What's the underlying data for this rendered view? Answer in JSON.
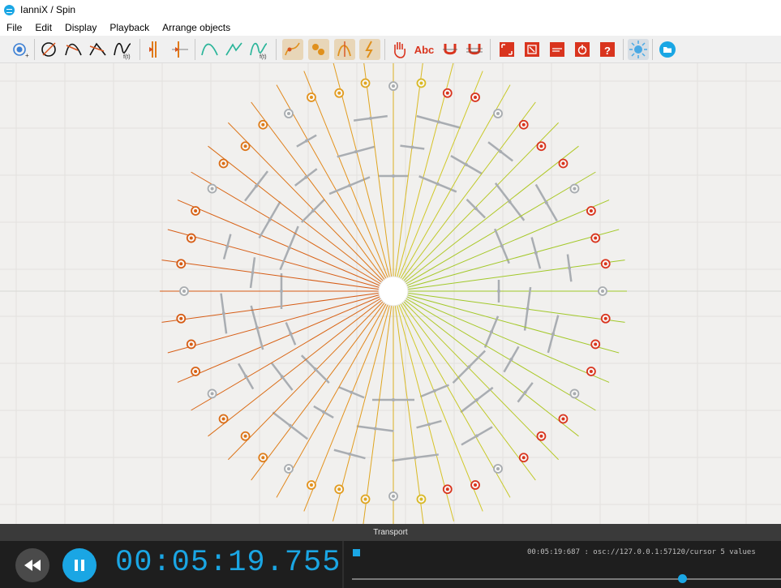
{
  "window": {
    "title": "IanniX / Spin"
  },
  "menu": [
    "File",
    "Edit",
    "Display",
    "Playback",
    "Arrange objects"
  ],
  "toolbar": [
    {
      "icon": "add-trigger-icon",
      "color": "#3b7fd4"
    },
    {
      "icon": "add-circle-curve-icon",
      "color": "#d9541e"
    },
    {
      "icon": "add-curve-icon",
      "color": "#d9541e"
    },
    {
      "icon": "add-segment-curve-icon",
      "color": "#d9541e"
    },
    {
      "icon": "add-math-curve-icon",
      "color": "#d9541e"
    },
    {
      "icon": "add-cursor-icon",
      "color": "#e07a18"
    },
    {
      "icon": "add-cursor-line-icon",
      "color": "#e07a18"
    },
    {
      "icon": "add-curve-cursor-icon",
      "color": "#2bb59a"
    },
    {
      "icon": "add-curve-cursor-segment-icon",
      "color": "#2bb59a"
    },
    {
      "icon": "add-math-curve-cursor-icon",
      "color": "#2bb59a"
    },
    {
      "icon": "snap-curve-icon",
      "color": "#e0901c"
    },
    {
      "icon": "snap-trigger-icon",
      "color": "#e0901c"
    },
    {
      "icon": "snap-cursor-icon",
      "color": "#e0901c"
    },
    {
      "icon": "snap-lightning-icon",
      "color": "#e0901c"
    },
    {
      "icon": "hand-icon",
      "color": "#d9341e"
    },
    {
      "icon": "text-label-icon",
      "color": "#d9341e",
      "label": "Abc"
    },
    {
      "icon": "magnet-icon",
      "color": "#d9341e"
    },
    {
      "icon": "magnet-grid-icon",
      "color": "#d9341e"
    },
    {
      "icon": "fullscreen-icon",
      "color": "#d9341e"
    },
    {
      "icon": "close-window-icon",
      "color": "#d9341e"
    },
    {
      "icon": "script-icon",
      "color": "#d9341e"
    },
    {
      "icon": "power-icon",
      "color": "#d9341e"
    },
    {
      "icon": "help-icon",
      "color": "#d9341e"
    },
    {
      "icon": "light-icon",
      "color": "#4aa9e4"
    },
    {
      "icon": "folder-icon",
      "color": "#1aa6e4"
    }
  ],
  "transport": {
    "panel_title": "Transport",
    "time": "00:05:19.755",
    "osc_message": "00:05:19:687 : osc://127.0.0.1:57120/cursor 5 values",
    "progress": 0.77,
    "accent": "#1aa6e4"
  },
  "score": {
    "rays": 48,
    "background": "#f1f0ee",
    "grid_color": "#e2e1de"
  }
}
